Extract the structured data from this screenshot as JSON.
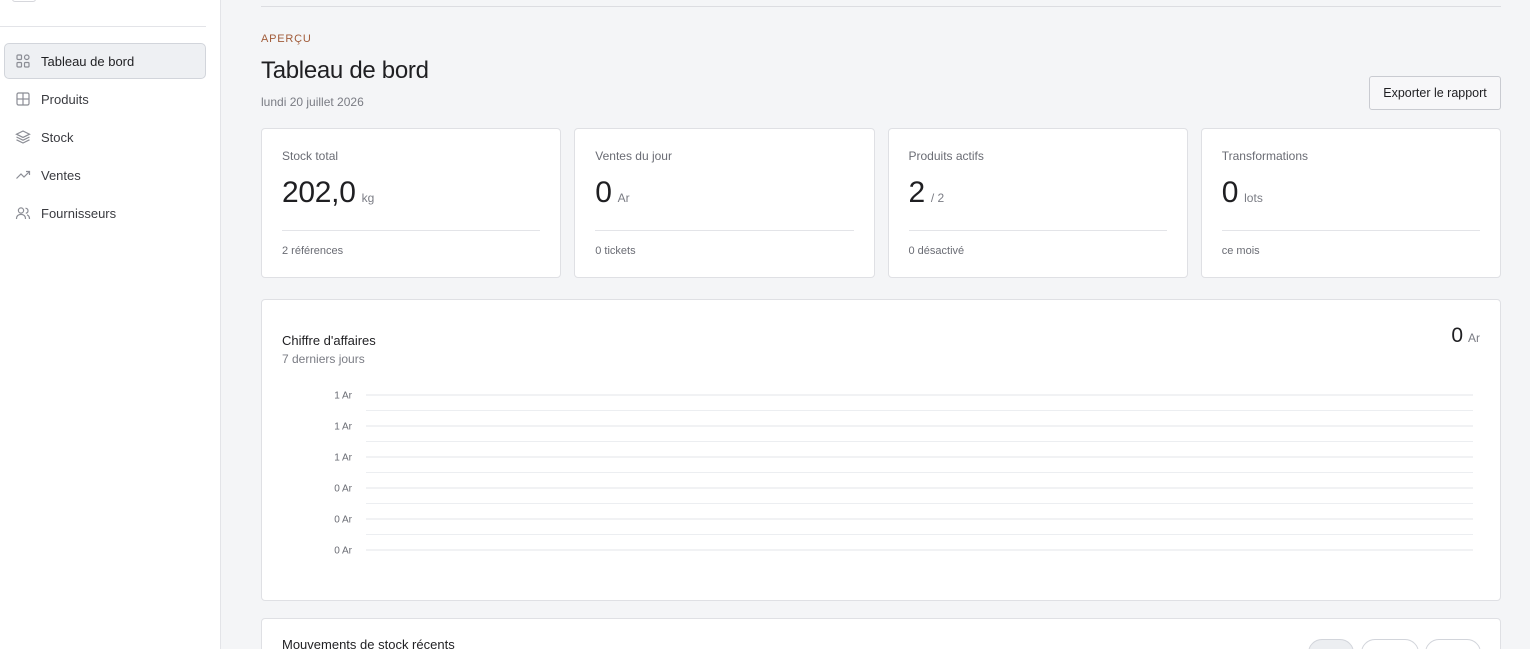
{
  "sidebar": {
    "items": [
      {
        "label": "Tableau de bord",
        "icon": "grid-icon",
        "active": true
      },
      {
        "label": "Produits",
        "icon": "table-icon",
        "active": false
      },
      {
        "label": "Stock",
        "icon": "layers-icon",
        "active": false
      },
      {
        "label": "Ventes",
        "icon": "trend-up-icon",
        "active": false
      },
      {
        "label": "Fournisseurs",
        "icon": "users-icon",
        "active": false
      }
    ]
  },
  "header": {
    "eyebrow": "APERÇU",
    "title": "Tableau de bord",
    "date": "lundi 20 juillet 2026",
    "export_label": "Exporter le rapport"
  },
  "stats": [
    {
      "label": "Stock total",
      "value": "202,0",
      "unit": "kg",
      "foot": "2 références"
    },
    {
      "label": "Ventes du jour",
      "value": "0",
      "unit": "Ar",
      "foot": "0 tickets"
    },
    {
      "label": "Produits actifs",
      "value": "2",
      "unit": "/ 2",
      "foot": "0 désactivé"
    },
    {
      "label": "Transformations",
      "value": "0",
      "unit": "lots",
      "foot": "ce mois"
    }
  ],
  "revenue": {
    "title": "Chiffre d'affaires",
    "subtitle": "7 derniers jours",
    "total_value": "0",
    "total_unit": "Ar"
  },
  "chart_data": {
    "type": "line",
    "title": "Chiffre d'affaires",
    "subtitle": "7 derniers jours",
    "y_tick_labels": [
      "1 Ar",
      "1 Ar",
      "1 Ar",
      "0 Ar",
      "0 Ar",
      "0 Ar"
    ],
    "series": [],
    "grid": true
  },
  "moves": {
    "title": "Mouvements de stock récents"
  },
  "colors": {
    "accent_eyebrow": "#a15c3a",
    "gridline": "#e3e4e8",
    "card_border": "#dfe0e4"
  }
}
